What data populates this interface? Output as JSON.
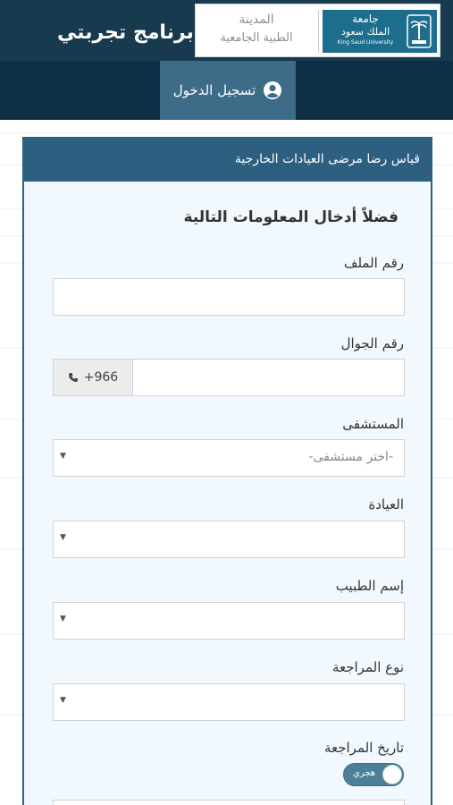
{
  "header": {
    "app_title": "برنامج تجربتي",
    "logo_medical_line1": "المدينة",
    "logo_medical_line2": "الطبية الجامعية",
    "logo_ksu_line1": "جامعة",
    "logo_ksu_line2": "الملك سعود",
    "logo_ksu_en": "King Saud University"
  },
  "nav": {
    "login_label": "تسجيل الدخول"
  },
  "panel": {
    "title": "قياس رضا مرضى العيادات الخارجية",
    "heading": "فضلاً أدخال المعلومات التالية"
  },
  "form": {
    "file_number_label": "رقم الملف",
    "file_number_value": "",
    "mobile_label": "رقم الجوال",
    "mobile_prefix": "+966",
    "mobile_value": "",
    "hospital_label": "المستشفى",
    "hospital_placeholder": "-اختر مستشفى-",
    "clinic_label": "العيادة",
    "clinic_value": "",
    "doctor_label": "إسم الطبيب",
    "doctor_value": "",
    "visit_type_label": "نوع المراجعة",
    "visit_type_value": "",
    "visit_date_label": "تاريخ المراجعة",
    "calendar_toggle_label": "هجري",
    "visit_date_value": ""
  },
  "colors": {
    "header_bg": "#173a4f",
    "nav_bg": "#0f3044",
    "nav_active": "#3d6c89",
    "panel_border": "#2d5f80",
    "panel_bg": "#f2f9fe"
  }
}
